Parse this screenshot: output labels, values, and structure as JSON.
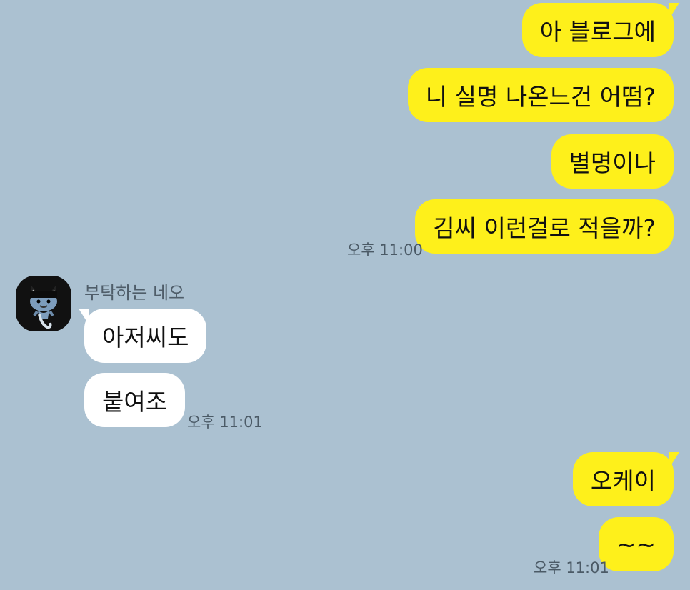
{
  "theme": {
    "background": "#abc1d1",
    "my_bubble": "#fef01b",
    "their_bubble": "#ffffff"
  },
  "messages": [
    {
      "text": "아 블로그에"
    },
    {
      "text": "니 실명 나온느건 어떰?"
    },
    {
      "text": "별명이나"
    },
    {
      "text": "김씨 이런걸로 적을까?",
      "time": "오후 11:00"
    },
    {
      "sender": "부탁하는 네오",
      "avatar": "neo-cat-character-icon",
      "text": "아저씨도"
    },
    {
      "text": "붙여조",
      "time": "오후 11:01"
    },
    {
      "text": "오케이"
    },
    {
      "text": "~~",
      "time": "오후 11:01"
    }
  ]
}
